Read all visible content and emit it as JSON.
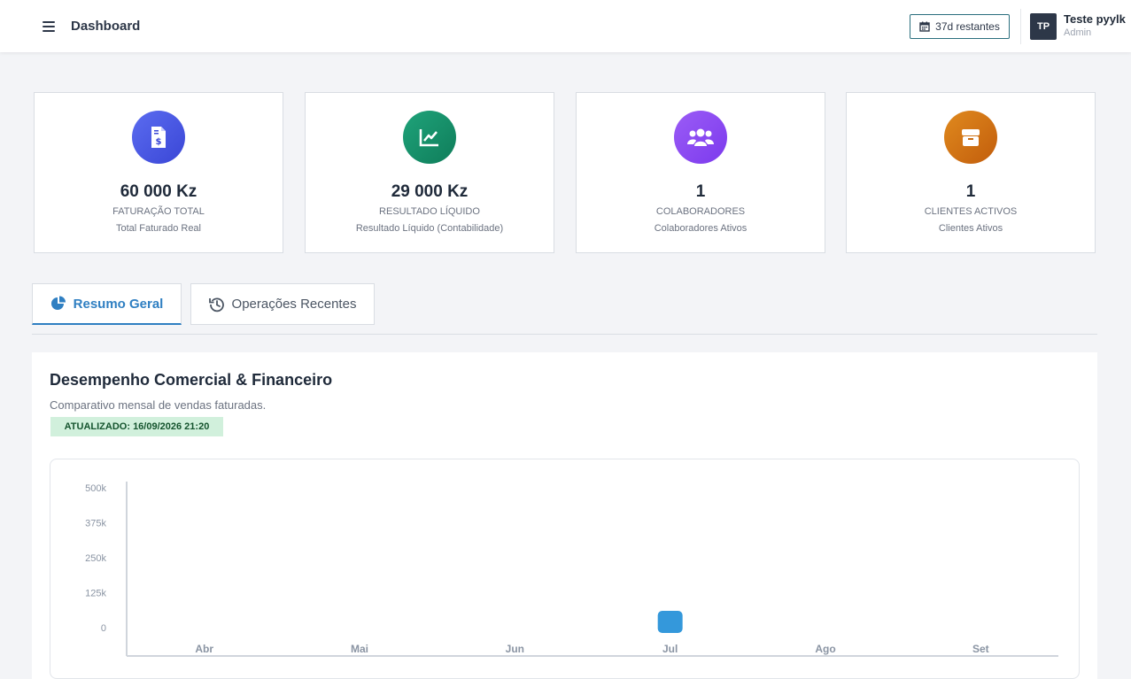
{
  "header": {
    "title": "Dashboard",
    "days_remaining": "37d restantes",
    "user": {
      "initials": "TP",
      "name": "Teste pyylk",
      "role": "Admin"
    }
  },
  "cards": [
    {
      "value": "60 000 Kz",
      "label": "FATURAÇÃO TOTAL",
      "sublabel": "Total Faturado Real",
      "icon": "invoice-dollar-icon",
      "color_start": "#5b6cf0",
      "color_end": "#3a46d6"
    },
    {
      "value": "29 000 Kz",
      "label": "RESULTADO LÍQUIDO",
      "sublabel": "Resultado Líquido (Contabilidade)",
      "icon": "chart-line-icon",
      "color_start": "#1fa37a",
      "color_end": "#0f7d5a"
    },
    {
      "value": "1",
      "label": "COLABORADORES",
      "sublabel": "Colaboradores Ativos",
      "icon": "users-icon",
      "color_start": "#9b5cf6",
      "color_end": "#7c3aed"
    },
    {
      "value": "1",
      "label": "CLIENTES ACTIVOS",
      "sublabel": "Clientes Ativos",
      "icon": "box-icon",
      "color_start": "#e08a1e",
      "color_end": "#c25d0c"
    }
  ],
  "tabs": [
    {
      "label": "Resumo Geral",
      "icon": "pie-chart-icon",
      "active": true
    },
    {
      "label": "Operações Recentes",
      "icon": "history-icon",
      "active": false
    }
  ],
  "panel": {
    "title": "Desempenho Comercial & Financeiro",
    "subtitle": "Comparativo mensal de vendas faturadas.",
    "updated": "ATUALIZADO: 16/09/2026 21:20"
  },
  "chart_data": {
    "type": "bar",
    "categories": [
      "Abr",
      "Mai",
      "Jun",
      "Jul",
      "Ago",
      "Set"
    ],
    "values": [
      0,
      0,
      0,
      60000,
      0,
      0
    ],
    "ylim": [
      0,
      500000
    ],
    "yticks": [
      "0",
      "125k",
      "250k",
      "375k",
      "500k"
    ],
    "ytick_values": [
      0,
      125000,
      250000,
      375000,
      500000
    ],
    "bar_color": "#3498db",
    "grid": false
  }
}
